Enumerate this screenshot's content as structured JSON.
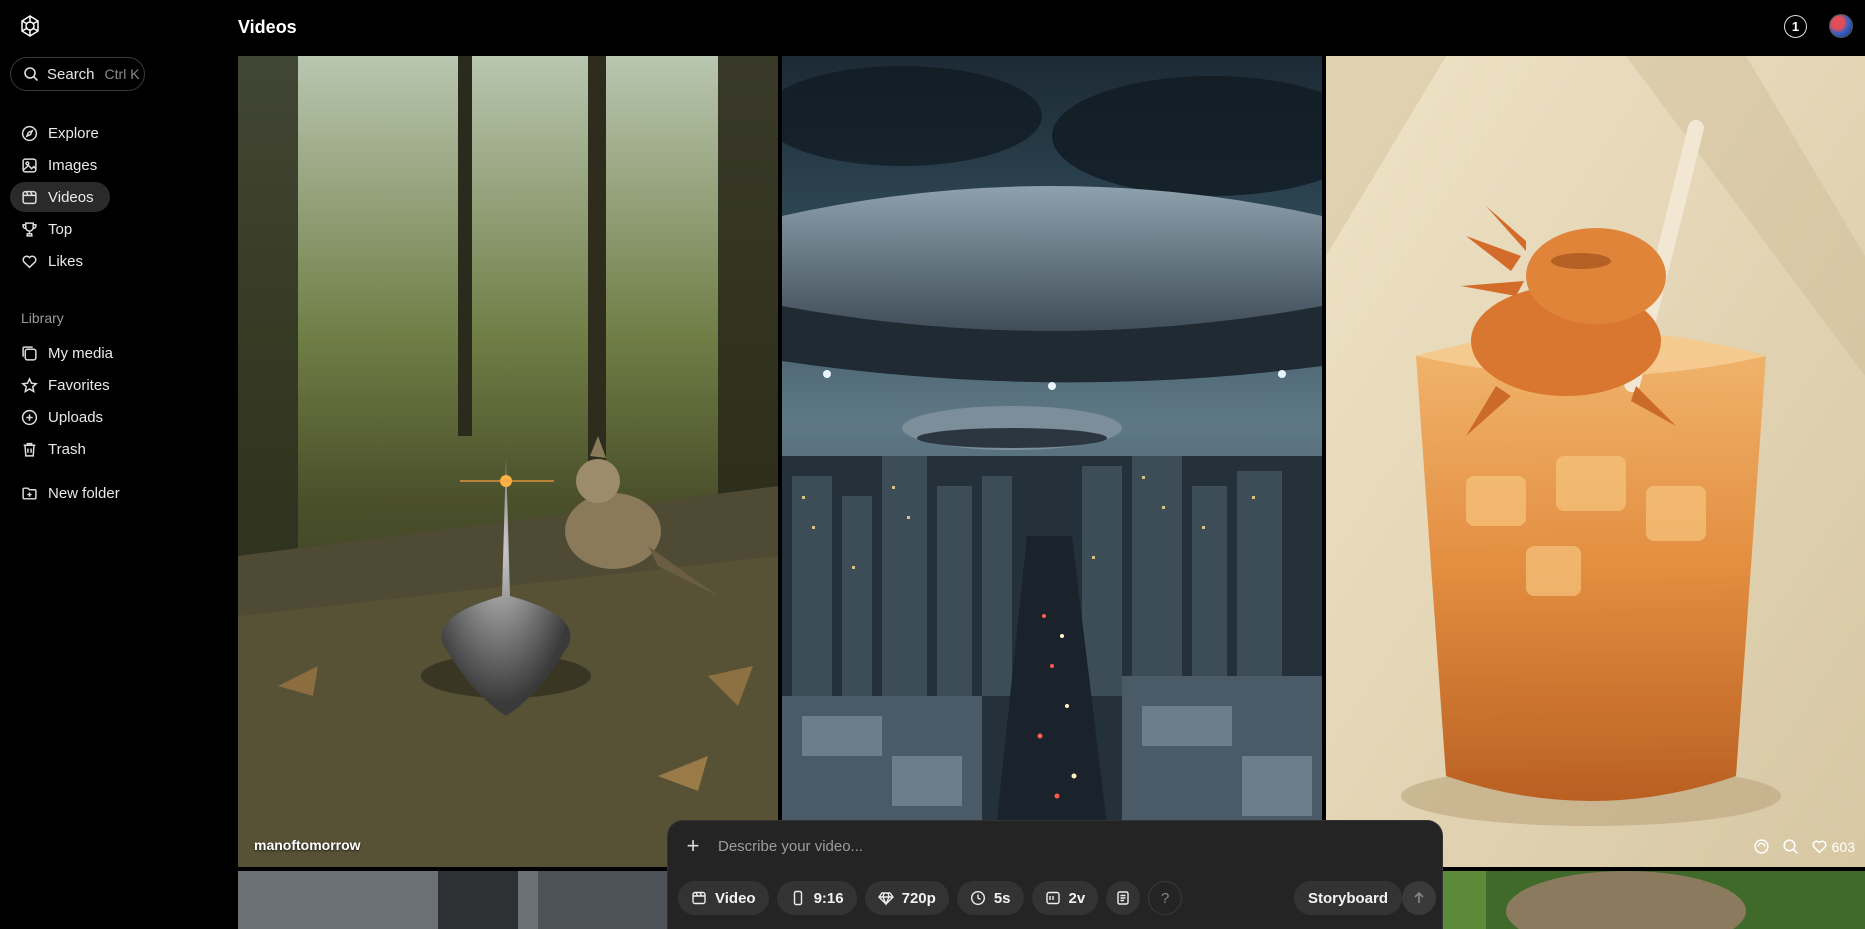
{
  "app": {
    "title": "Videos"
  },
  "search": {
    "label": "Search",
    "shortcut": "Ctrl K"
  },
  "nav": {
    "items": [
      {
        "label": "Explore",
        "icon": "compass-icon"
      },
      {
        "label": "Images",
        "icon": "image-icon"
      },
      {
        "label": "Videos",
        "icon": "video-icon",
        "active": true
      },
      {
        "label": "Top",
        "icon": "trophy-icon"
      },
      {
        "label": "Likes",
        "icon": "heart-icon"
      }
    ]
  },
  "library": {
    "label": "Library",
    "items": [
      {
        "label": "My media",
        "icon": "media-icon"
      },
      {
        "label": "Favorites",
        "icon": "star-icon"
      },
      {
        "label": "Uploads",
        "icon": "upload-icon"
      },
      {
        "label": "Trash",
        "icon": "trash-icon"
      }
    ],
    "new_folder": "New folder"
  },
  "header": {
    "notification_count": "1"
  },
  "tiles": [
    {
      "credit": "manoftomorrow"
    },
    {
      "credit": ""
    },
    {
      "likes": "603"
    }
  ],
  "composer": {
    "placeholder": "Describe your video...",
    "chips": {
      "type": "Video",
      "aspect": "9:16",
      "resolution": "720p",
      "duration": "5s",
      "variations": "2v",
      "help": "?"
    },
    "storyboard": "Storyboard"
  },
  "colors": {
    "background": "#000000",
    "composer": "#242424",
    "chip": "#333333"
  }
}
